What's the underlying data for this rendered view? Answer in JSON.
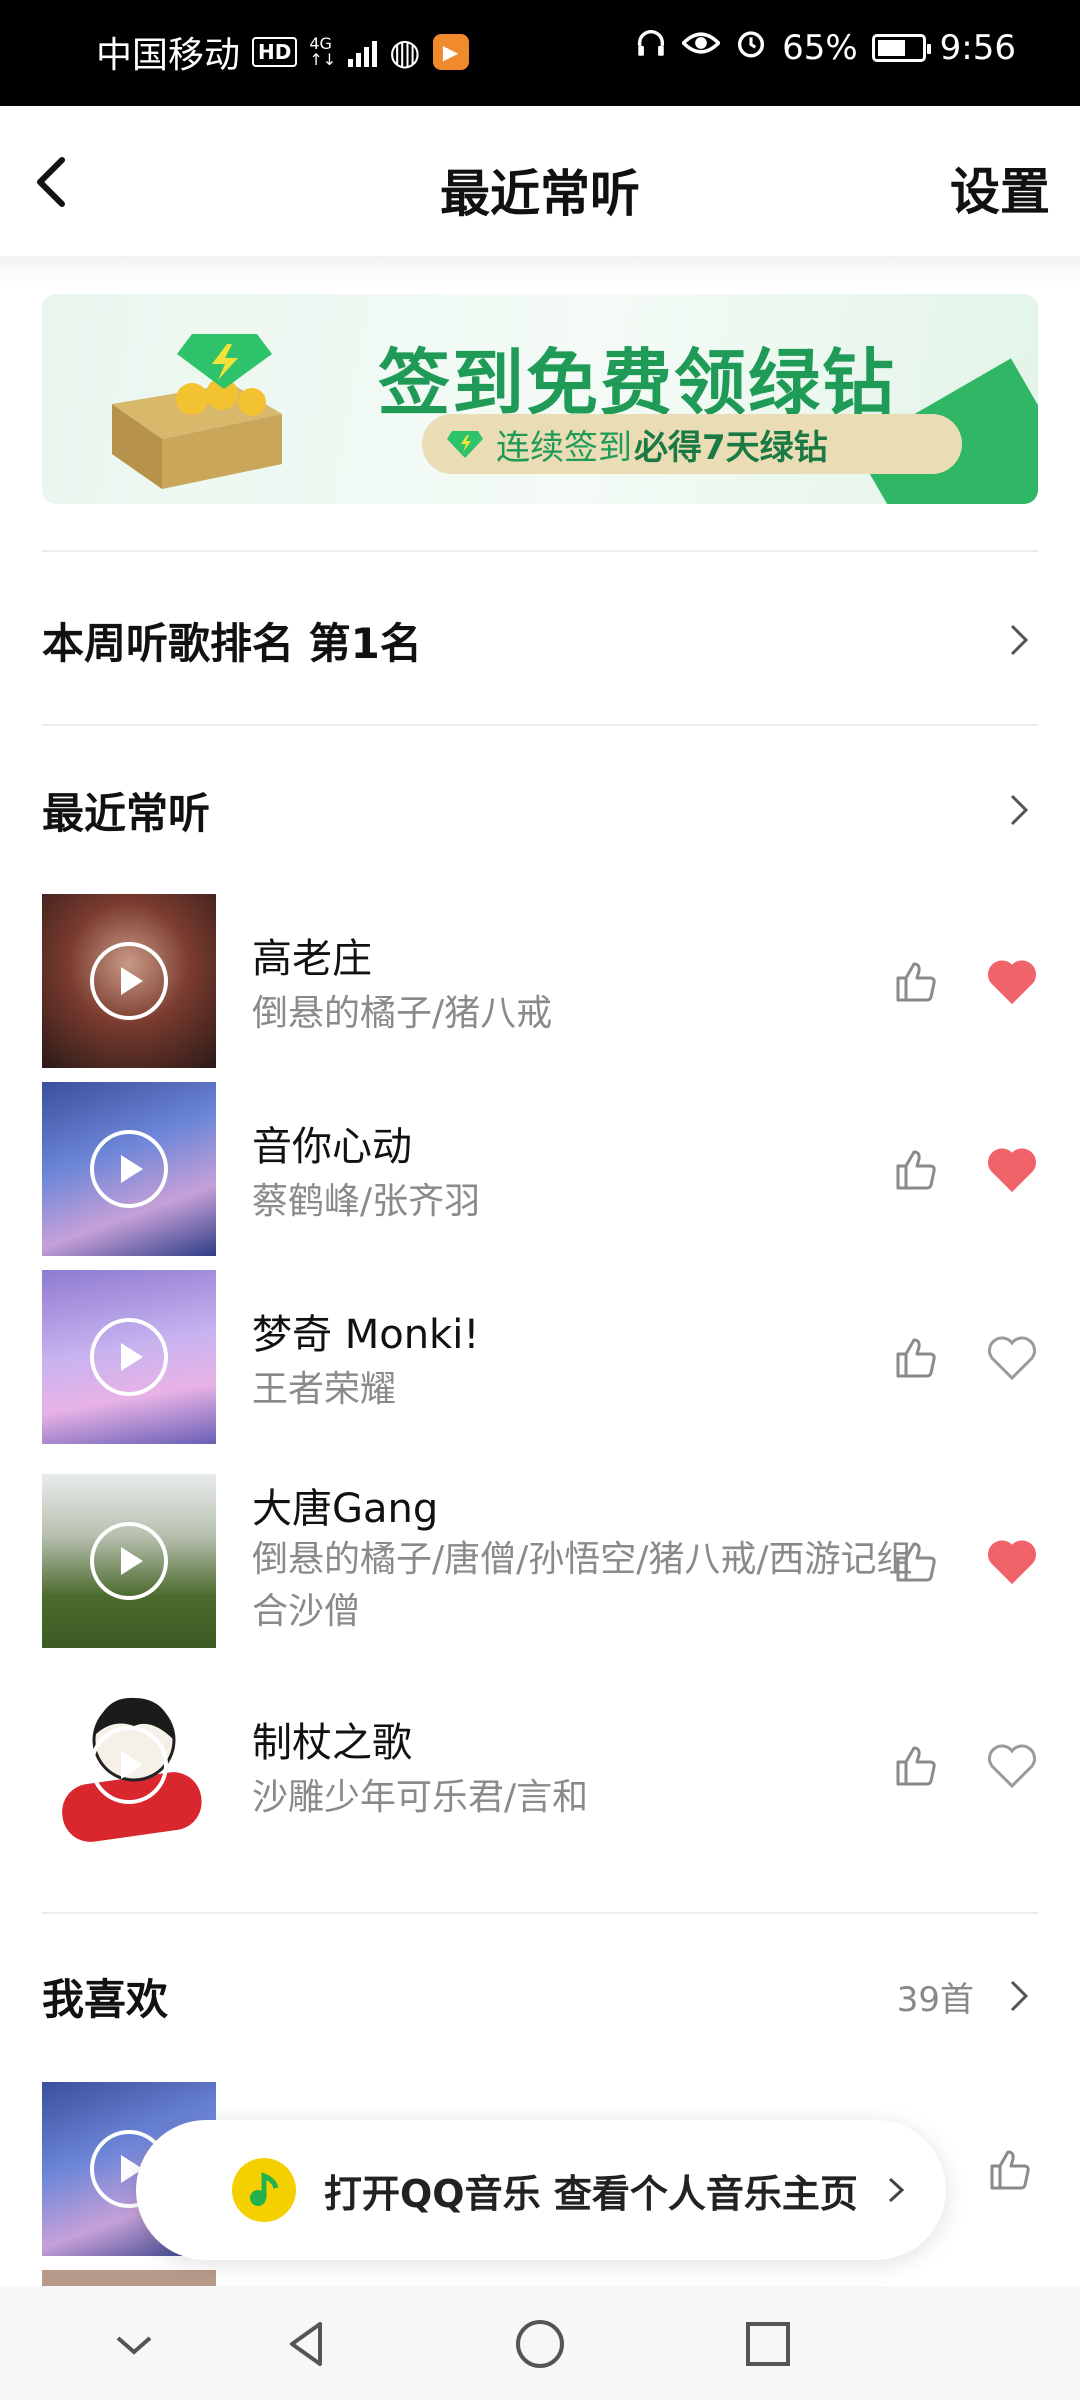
{
  "status_bar": {
    "carrier": "中国移动",
    "hd": "HD",
    "network": "4G",
    "battery_percent": "65%",
    "battery_level": 0.65,
    "time": "9:56"
  },
  "header": {
    "title": "最近常听",
    "settings_label": "设置"
  },
  "banner": {
    "title": "签到免费领绿钻",
    "subtitle_prefix": "连续签到",
    "subtitle_bold": "必得7天绿钻"
  },
  "weekly_rank": {
    "label": "本周听歌排名 第1名"
  },
  "recent_section": {
    "title": "最近常听",
    "songs": [
      {
        "title": "高老庄",
        "artist": "倒悬的橘子/猪八戒",
        "liked": true
      },
      {
        "title": "音你心动",
        "artist": "蔡鹤峰/张齐羽",
        "liked": true
      },
      {
        "title": "梦奇 Monki!",
        "artist": "王者荣耀",
        "liked": false
      },
      {
        "title": "大唐Gang",
        "artist": "倒悬的橘子/唐僧/孙悟空/猪八戒/西游记组合沙僧",
        "liked": true
      },
      {
        "title": "制杖之歌",
        "artist": "沙雕少年可乐君/言和",
        "liked": false
      }
    ]
  },
  "favorites_section": {
    "title": "我喜欢",
    "count": "39首"
  },
  "open_app_bar": {
    "label": "打开QQ音乐 查看个人音乐主页"
  },
  "colors": {
    "heart_active": "#f0636a",
    "icon_gray": "#9a9a9a",
    "brand_green": "#1f9b57"
  }
}
